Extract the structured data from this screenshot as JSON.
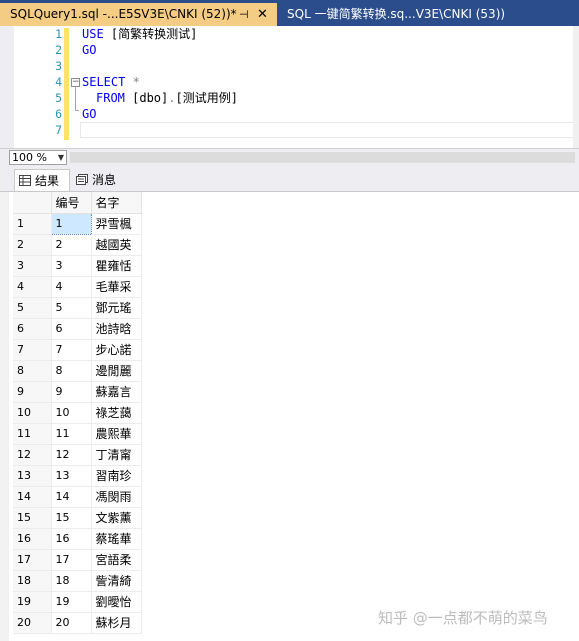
{
  "tabs": {
    "active_title": "SQLQuery1.sql -...E5SV3E\\CNKI (52))*",
    "pin_glyph": "⊣",
    "close_glyph": "✕",
    "inactive_title": "SQL 一键简繁转换.sq...V3E\\CNKI (53))"
  },
  "editor": {
    "line_numbers": [
      "1",
      "2",
      "3",
      "4",
      "5",
      "6",
      "7"
    ],
    "line1_kw": "USE",
    "line1_rest": " [简繁转换测试]",
    "line2": "GO",
    "line4_kw": "SELECT",
    "line4_rest": " *",
    "line5_kw": "FROM",
    "line5_a": " [dbo]",
    "line5_dot": ".",
    "line5_b": "[测试用例]",
    "line6": "GO"
  },
  "zoom": {
    "value": "100 %"
  },
  "result_tabs": {
    "results": "结果",
    "messages": "消息"
  },
  "grid": {
    "columns": [
      "编号",
      "名字"
    ],
    "rows": [
      [
        "1",
        "1",
        "羿雪楓"
      ],
      [
        "2",
        "2",
        "越國英"
      ],
      [
        "3",
        "3",
        "瞿雍恬"
      ],
      [
        "4",
        "4",
        "毛華采"
      ],
      [
        "5",
        "5",
        "鄧元瑤"
      ],
      [
        "6",
        "6",
        "池詩晗"
      ],
      [
        "7",
        "7",
        "步心諾"
      ],
      [
        "8",
        "8",
        "邊閒麗"
      ],
      [
        "9",
        "9",
        "蘇嘉言"
      ],
      [
        "10",
        "10",
        "祿芝藹"
      ],
      [
        "11",
        "11",
        "農熙華"
      ],
      [
        "12",
        "12",
        "丁清甯"
      ],
      [
        "13",
        "13",
        "習南珍"
      ],
      [
        "14",
        "14",
        "馮閔雨"
      ],
      [
        "15",
        "15",
        "文紫薰"
      ],
      [
        "16",
        "16",
        "蔡瑤華"
      ],
      [
        "17",
        "17",
        "宮語柔"
      ],
      [
        "18",
        "18",
        "訾清綺"
      ],
      [
        "19",
        "19",
        "劉曖怡"
      ],
      [
        "20",
        "20",
        "蘇杉月"
      ]
    ]
  },
  "watermark": "知乎 @一点都不萌的菜鸟"
}
